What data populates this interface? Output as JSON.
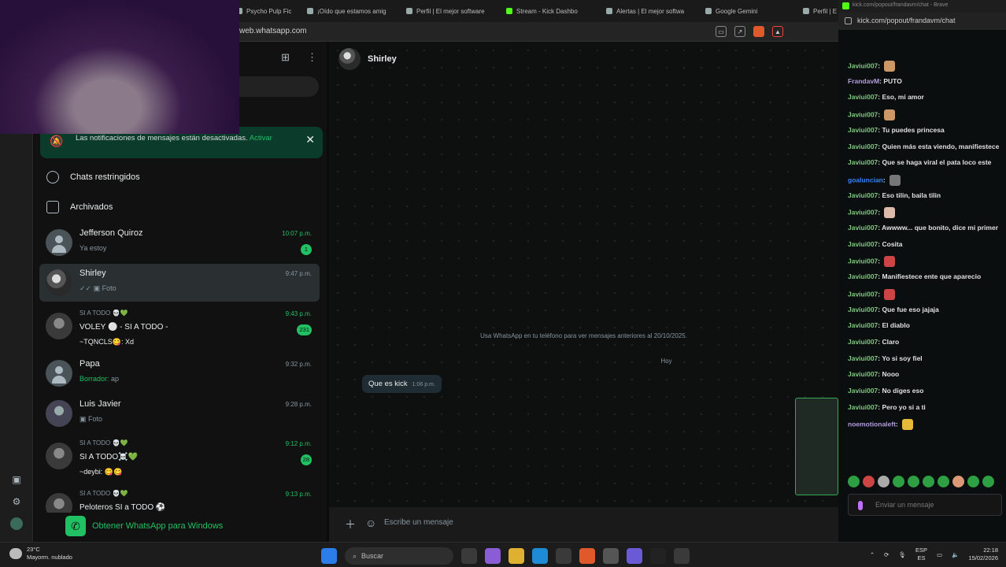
{
  "browser": {
    "tabs": [
      "Psycho Pulp Fict",
      "¡Oído que estamos amig",
      "Perfil | El mejor software",
      "Stream - Kick Dashbo",
      "Alertas | El mejor softwa",
      "Google Gemini",
      "Perfil | E"
    ],
    "url": "web.whatsapp.com"
  },
  "whatsapp": {
    "notification": {
      "text": "Las notificaciones de mensajes están desactivadas.",
      "action": "Activar"
    },
    "menu": [
      {
        "label": "Chats restringidos",
        "icon": "lock-icon"
      },
      {
        "label": "Archivados",
        "icon": "archive-icon"
      }
    ],
    "chats": [
      {
        "name": "Jefferson Quiroz",
        "line1": "Ya estoy",
        "time": "10:07 p.m.",
        "unread": true,
        "badge": "1"
      },
      {
        "name": "Shirley",
        "line1": "Foto",
        "time": "9:47 p.m.",
        "unread": false,
        "badge": ""
      },
      {
        "name": "SI A TODO 💀💚",
        "line1": "VOLEY ⚪ - SI A TODO -",
        "line2": "~TQNCLS😋: Xd",
        "time": "9:43 p.m.",
        "unread": true,
        "badge": "231"
      },
      {
        "name": "Papa",
        "draft_label": "Borrador:",
        "line1": "ap",
        "time": "9:32 p.m.",
        "unread": false,
        "badge": ""
      },
      {
        "name": "Luis Javier",
        "line1": "Foto",
        "time": "9:28 p.m.",
        "unread": false,
        "badge": ""
      },
      {
        "name": "SI A TODO 💀💚",
        "line1": "SI A TODO☠️💚",
        "line2": "~deybi: 😋😋",
        "time": "9:12 p.m.",
        "unread": true,
        "badge": "28"
      },
      {
        "name": "SI A TODO 💀💚",
        "line1": "Peloteros SI a TODO ⚽",
        "time": "9:13 p.m.",
        "unread": true,
        "badge": ""
      }
    ],
    "get_app": "Obtener WhatsApp para Windows",
    "conversation": {
      "title": "Shirley",
      "system_message": "Usa WhatsApp en tu teléfono para ver mensajes anteriores al 20/10/2025.",
      "day_label": "Hoy",
      "message": {
        "text": "Que es kick",
        "time": "1:06 p.m."
      },
      "composer_placeholder": "Escribe un mensaje"
    }
  },
  "kick": {
    "window_title": "kick.com/popout/frandavm/chat - Brave",
    "url": "kick.com/popout/frandavm/chat",
    "messages": [
      {
        "user": "Javiui007",
        "text": "",
        "emote": "#c96"
      },
      {
        "user": "FrandavM",
        "text": "PUTO",
        "color": "purple"
      },
      {
        "user": "Javiui007",
        "text": "Eso, mi amor"
      },
      {
        "user": "Javiui007",
        "text": "",
        "emote": "#c96"
      },
      {
        "user": "Javiui007",
        "text": "Tu puedes princesa"
      },
      {
        "user": "Javiui007",
        "text": "Quien más esta viendo, manifiestece"
      },
      {
        "user": "Javiui007",
        "text": "Que se haga viral el pata loco este"
      },
      {
        "user": "goaluncian",
        "text": "",
        "color": "blue",
        "emote": "#777"
      },
      {
        "user": "Javiui007",
        "text": "Eso tilin, baila tilin"
      },
      {
        "user": "Javiui007",
        "text": "",
        "emote": "#dba"
      },
      {
        "user": "Javiui007",
        "text": "Awwww... que bonito, dice mi primer"
      },
      {
        "user": "Javiui007",
        "text": "Cosita"
      },
      {
        "user": "Javiui007",
        "text": "",
        "emote": "#c44"
      },
      {
        "user": "Javiui007",
        "text": "Manifiestece ente que aparecio"
      },
      {
        "user": "Javiui007",
        "text": "",
        "emote": "#c44"
      },
      {
        "user": "Javiui007",
        "text": "Que fue eso jajaja"
      },
      {
        "user": "Javiui007",
        "text": "El diablo"
      },
      {
        "user": "Javiui007",
        "text": "Claro"
      },
      {
        "user": "Javiui007",
        "text": "Yo si soy fiel"
      },
      {
        "user": "Javiui007",
        "text": "Nooo"
      },
      {
        "user": "Javiui007",
        "text": "No diges eso"
      },
      {
        "user": "Javiui007",
        "text": "Pero yo si a ti"
      },
      {
        "user": "noemotionaleft",
        "text": "",
        "color": "purple",
        "emote": "#e6b93a"
      }
    ],
    "input_placeholder": "Enviar un mensaje"
  },
  "taskbar": {
    "weather_temp": "23°C",
    "weather_desc": "Mayorm. nublado",
    "search_placeholder": "Buscar",
    "lang_1": "ESP",
    "lang_2": "ES",
    "time": "22:18",
    "date": "15/02/2026"
  }
}
